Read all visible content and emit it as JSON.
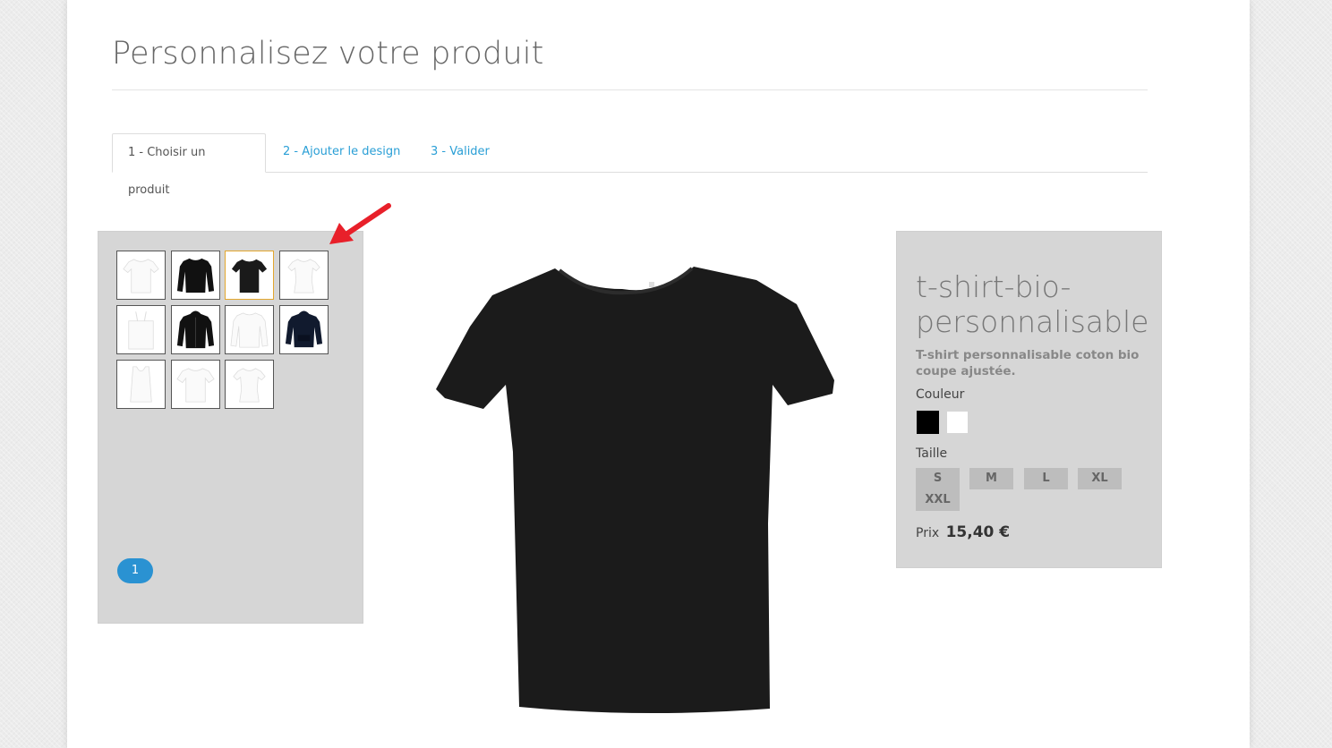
{
  "page": {
    "title": "Personnalisez votre produit"
  },
  "tabs": [
    {
      "label": "1 - Choisir un produit",
      "active": true
    },
    {
      "label": "2 - Ajouter le design",
      "active": false
    },
    {
      "label": "3 - Valider",
      "active": false
    }
  ],
  "catalog": {
    "thumbnails": [
      {
        "item": "white-tshirt",
        "color": "#ffffff"
      },
      {
        "item": "black-longsleeve-sweatshirt",
        "color": "#111111"
      },
      {
        "item": "black-tshirt",
        "color": "#1a1a1a",
        "selected": true
      },
      {
        "item": "white-womens-tshirt",
        "color": "#ffffff"
      },
      {
        "item": "white-tote-bag",
        "color": "#ffffff"
      },
      {
        "item": "black-hoodie-zip",
        "color": "#111111"
      },
      {
        "item": "white-longsleeve",
        "color": "#ffffff"
      },
      {
        "item": "navy-hoodie",
        "color": "#111a2e"
      },
      {
        "item": "white-tank-top",
        "color": "#ffffff"
      },
      {
        "item": "white-tshirt-mens",
        "color": "#ffffff"
      },
      {
        "item": "white-womens-fitted-tshirt",
        "color": "#ffffff"
      }
    ],
    "pager_current": "1"
  },
  "product": {
    "name": "t-shirt-bio-personnalisable",
    "description": "T-shirt personnalisable coton bio coupe ajustée.",
    "color_label": "Couleur",
    "colors": [
      "#000000",
      "#ffffff"
    ],
    "size_label": "Taille",
    "sizes": [
      "S",
      "M",
      "L",
      "XL",
      "XXL"
    ],
    "price_label": "Prix",
    "price": "15,40 €"
  },
  "accent_colors": {
    "link": "#2a9fd6",
    "pager": "#2a92d2",
    "selected_border": "#e3a72f",
    "arrow": "#e8202a"
  }
}
